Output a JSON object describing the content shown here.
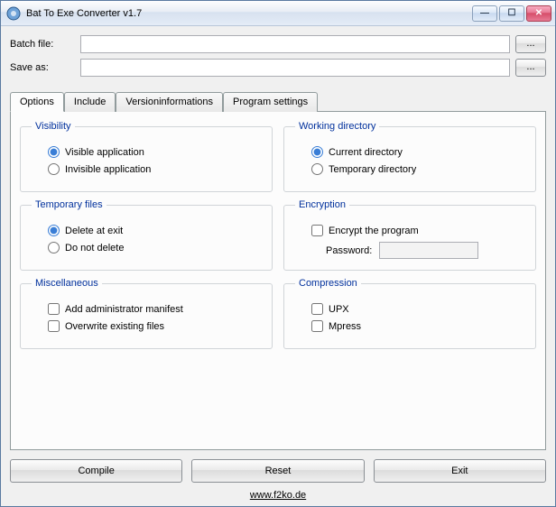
{
  "window": {
    "title": "Bat To Exe Converter v1.7"
  },
  "file_inputs": {
    "batch_label": "Batch file:",
    "batch_value": "",
    "saveas_label": "Save as:",
    "saveas_value": "",
    "browse_label": "..."
  },
  "tabs": {
    "options": "Options",
    "include": "Include",
    "versioninfo": "Versioninformations",
    "progsettings": "Program settings"
  },
  "groups": {
    "visibility": {
      "legend": "Visibility",
      "visible": "Visible application",
      "invisible": "Invisible application"
    },
    "workdir": {
      "legend": "Working directory",
      "current": "Current directory",
      "temp": "Temporary directory"
    },
    "tempfiles": {
      "legend": "Temporary files",
      "delete": "Delete at exit",
      "keep": "Do not delete"
    },
    "encryption": {
      "legend": "Encryption",
      "encrypt": "Encrypt the program",
      "password_label": "Password:"
    },
    "misc": {
      "legend": "Miscellaneous",
      "admin": "Add administrator manifest",
      "overwrite": "Overwrite existing files"
    },
    "compression": {
      "legend": "Compression",
      "upx": "UPX",
      "mpress": "Mpress"
    }
  },
  "buttons": {
    "compile": "Compile",
    "reset": "Reset",
    "exit": "Exit"
  },
  "footer": {
    "link_text": "www.f2ko.de"
  }
}
